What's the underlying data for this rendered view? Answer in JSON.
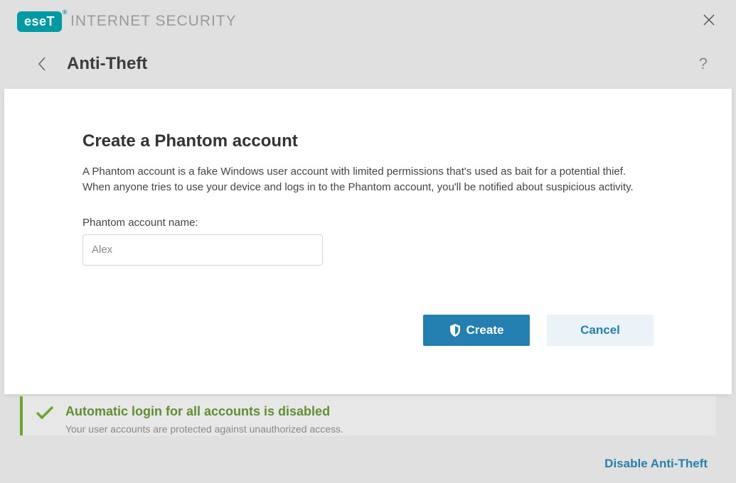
{
  "titlebar": {
    "logo_text": "eseT",
    "product_name": "INTERNET SECURITY"
  },
  "header": {
    "page_title": "Anti-Theft"
  },
  "modal": {
    "title": "Create a Phantom account",
    "description": "A Phantom account is a fake Windows user account with limited permissions that's used as bait for a potential thief. When anyone tries to use your device and logs in to the Phantom account, you'll be notified about suspicious activity.",
    "field_label": "Phantom account name:",
    "account_name_value": "Alex",
    "create_label": "Create",
    "cancel_label": "Cancel"
  },
  "status": {
    "title": "Automatic login for all accounts is disabled",
    "subtitle": "Your user accounts are protected against unauthorized access."
  },
  "footer": {
    "disable_link": "Disable Anti-Theft"
  }
}
